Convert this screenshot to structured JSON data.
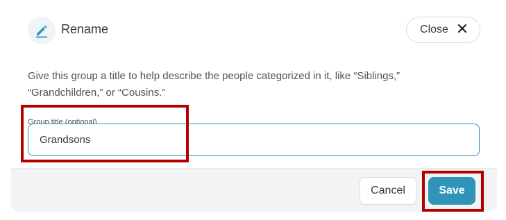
{
  "dialog": {
    "title": "Rename",
    "title_icon": "pencil-icon",
    "close_label": "Close",
    "close_icon": "close-icon",
    "description": "Give this group a title to help describe the people categorized in it, like “Siblings,” “Grandchildren,” or “Cousins.”",
    "field": {
      "label": "Group title (optional)",
      "value": "Grandsons"
    },
    "footer": {
      "cancel_label": "Cancel",
      "save_label": "Save"
    }
  },
  "colors": {
    "accent": "#2f94b8",
    "highlight": "#b30000",
    "footer_bg": "#f1f3f4"
  }
}
